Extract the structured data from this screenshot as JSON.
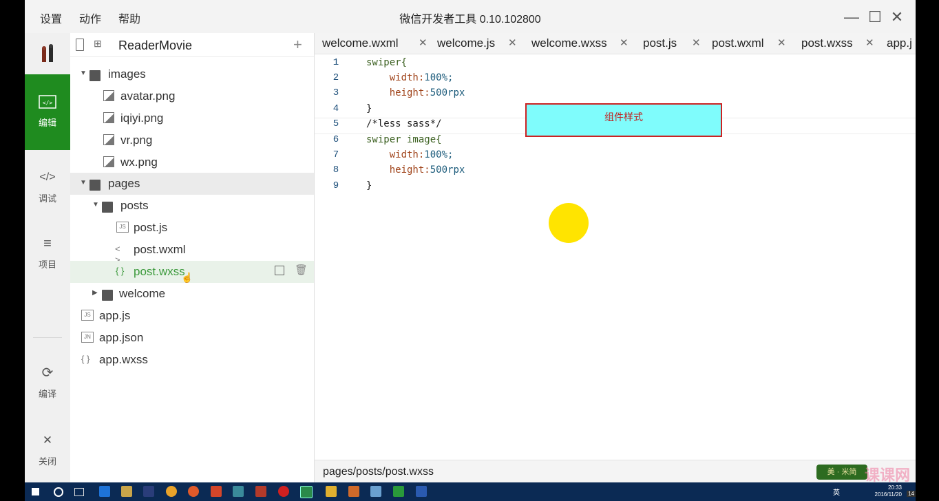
{
  "menu": {
    "settings": "设置",
    "actions": "动作",
    "help": "帮助"
  },
  "window": {
    "title": "微信开发者工具 0.10.102800",
    "minimize": "—",
    "maximize": "☐",
    "close": "✕"
  },
  "sidebar": {
    "items": [
      {
        "label": "编辑",
        "icon": "editor-icon",
        "glyph": "</>"
      },
      {
        "label": "调试",
        "icon": "debug-icon",
        "glyph": "</>"
      },
      {
        "label": "项目",
        "icon": "menu-icon",
        "glyph": "≡"
      },
      {
        "label": "编译",
        "icon": "compile-icon",
        "glyph": "⟳"
      },
      {
        "label": "关闭",
        "icon": "close-icon",
        "glyph": "✕"
      }
    ]
  },
  "project": {
    "name": "ReaderMovie",
    "add": "+"
  },
  "tree": [
    {
      "label": "images"
    },
    {
      "label": "avatar.png"
    },
    {
      "label": "iqiyi.png"
    },
    {
      "label": "vr.png"
    },
    {
      "label": "wx.png"
    },
    {
      "label": "pages"
    },
    {
      "label": "posts"
    },
    {
      "label": "post.js",
      "icon_text": "JS"
    },
    {
      "label": "post.wxml",
      "icon_text": "< >"
    },
    {
      "label": "post.wxss",
      "icon_text": "{ }"
    },
    {
      "label": "welcome"
    },
    {
      "label": "app.js",
      "icon_text": "JS"
    },
    {
      "label": "app.json",
      "icon_text": "JN"
    },
    {
      "label": "app.wxss",
      "icon_text": "{ }"
    }
  ],
  "tabs": [
    {
      "label": "welcome.wxml"
    },
    {
      "label": "welcome.js"
    },
    {
      "label": "welcome.wxss"
    },
    {
      "label": "post.js"
    },
    {
      "label": "post.wxml"
    },
    {
      "label": "post.wxss"
    },
    {
      "label": "app.j"
    }
  ],
  "tab_close": "✕",
  "code": {
    "lines": [
      {
        "n": "1",
        "a": "swiper{",
        "b": "",
        "c": ""
      },
      {
        "n": "2",
        "a": "    ",
        "b": "width:",
        "c": "100%;"
      },
      {
        "n": "3",
        "a": "    ",
        "b": "height:",
        "c": "500rpx"
      },
      {
        "n": "4",
        "a": "}",
        "b": "",
        "c": ""
      },
      {
        "n": "5",
        "a": "/*less sass*/",
        "b": "",
        "c": ""
      },
      {
        "n": "6",
        "a": "swiper image{",
        "b": "",
        "c": ""
      },
      {
        "n": "7",
        "a": "    ",
        "b": "width:",
        "c": "100%;"
      },
      {
        "n": "8",
        "a": "    ",
        "b": "height:",
        "c": "500rpx"
      },
      {
        "n": "9",
        "a": "}",
        "b": "",
        "c": ""
      }
    ]
  },
  "callout": "组件样式",
  "status": {
    "path": "pages/posts/post.wxss"
  },
  "watermark": {
    "badge": "美 · 米简",
    "site": "课课网"
  },
  "taskbar": {
    "time": "20:33",
    "date": "2016/11/20",
    "ime": "英",
    "notify": "14"
  },
  "colors": {
    "accent": "#1f8b1f",
    "callout_bg": "#7ffcfc",
    "callout_border": "#cc2222",
    "cursor_dot": "#ffe400",
    "taskbar": "#0b2a54"
  }
}
